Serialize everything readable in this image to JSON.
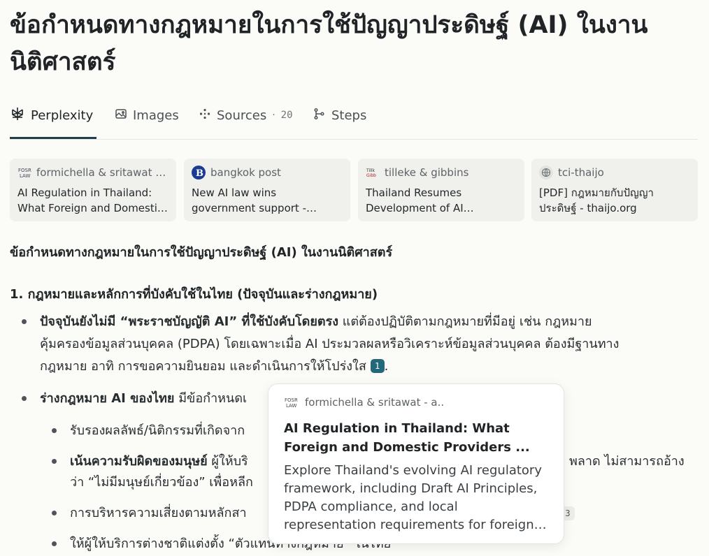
{
  "page": {
    "title": "ข้อกำหนดทางกฎหมายในการใช้ปัญญาประดิษฐ์ (AI) ในงานนิติศาสตร์"
  },
  "tabs": [
    {
      "label": "Perplexity",
      "icon": "perplexity-icon",
      "active": true
    },
    {
      "label": "Images",
      "icon": "image-icon",
      "active": false
    },
    {
      "label": "Sources",
      "icon": "sources-icon",
      "count": "20",
      "active": false
    },
    {
      "label": "Steps",
      "icon": "steps-icon",
      "active": false
    }
  ],
  "sources": [
    {
      "site": "formichella & sritawat -...",
      "title": "AI Regulation in Thailand: What Foreign and Domesti…",
      "icon": "formichella-logo"
    },
    {
      "site": "bangkok post",
      "title": "New AI law wins government support -…",
      "icon": "bangkok-post-logo"
    },
    {
      "site": "tilleke & gibbins",
      "title": "Thailand Resumes Development of AI…",
      "icon": "tilleke-logo"
    },
    {
      "site": "tci-thaijo",
      "title": "[PDF] กฎหมายกับปัญญาประดิษฐ์ - thaijo.org",
      "icon": "globe-icon"
    }
  ],
  "answer": {
    "heading": "ข้อกำหนดทางกฎหมายในการใช้ปัญญาประดิษฐ์ (AI) ในงานนิติศาสตร์",
    "section1_heading": "1. กฎหมายและหลักการที่บังคับใช้ในไทย (ปัจจุบันและร่างกฎหมาย)",
    "b1_bold": "ปัจจุบันยังไม่มี “พระราชบัญญัติ AI” ที่ใช้บังคับโดยตรง",
    "b1_line1_rest": " แต่ต้องปฏิบัติตามกฎหมายที่มีอยู่ เช่น กฎหมาย",
    "b1_line2": "คุ้มครองข้อมูลส่วนบุคคล (PDPA) โดยเฉพาะเมื่อ AI ประมวลผลหรือวิเคราะห์ข้อมูลส่วนบุคคล ต้องมีฐานทาง",
    "b1_line3": "กฎหมาย อาทิ การขอความยินยอม และดำเนินการให้โปร่งใส",
    "b1_cite": "1",
    "b1_end": ".",
    "b2_bold": "ร่างกฎหมาย AI ของไทย",
    "b2_rest": " มีข้อกำหนดเ",
    "sub1": "รับรองผลลัพธ์/นิติกรรมที่เกิดจาก",
    "sub2_bold": "เน้นความรับผิดของมนุษย์",
    "sub2_rest": " ผู้ให้บริ",
    "sub2_tail": "พลาด ไม่สามารถอ้าง",
    "sub2_line2": "ว่า “ไม่มีมนุษย์เกี่ยวข้อง” เพื่อหลีก",
    "sub3": "การบริหารความเสี่ยงตามหลักสา",
    "sub3_cite": "3",
    "sub4": "ให้ผู้ให้บริการต่างชาติแต่งตั้ง “ตัวแทนทางกฎหมาย” ในไทย"
  },
  "popup": {
    "site": "formichella & sritawat - a..",
    "title": "AI Regulation in Thailand: What Foreign and Domestic Providers ...",
    "description": "Explore Thailand's evolving AI regulatory framework, including Draft AI Principles, PDPA compliance, and local representation requirements for foreign providers. Prepar…"
  },
  "colors": {
    "accent": "#23697a",
    "background": "#fbfbf8",
    "card": "#f0f0ec"
  }
}
